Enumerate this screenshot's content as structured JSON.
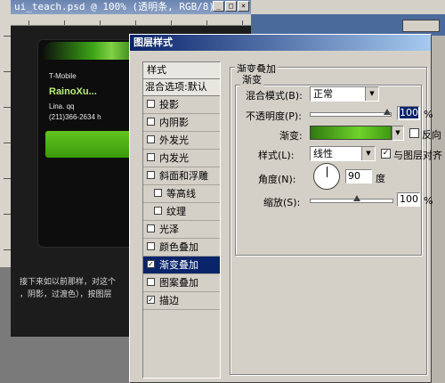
{
  "document": {
    "title": "ui_teach.psd @ 100% (透明条, RGB/8)",
    "phone": {
      "carrier": "T-Mobile",
      "name": "RainoXu...",
      "line1": "Lina. qq",
      "line2": "(211)366-2634 h"
    },
    "tutorial_text_line1": "接下来如以前那样，对这个",
    "tutorial_text_line2": "，阴影，过渡色），按图层"
  },
  "dialog": {
    "title": "图层样式",
    "styles_header": "样式",
    "blend_options": "混合选项:默认",
    "effects": [
      {
        "label": "投影",
        "checked": false,
        "sub": false
      },
      {
        "label": "内阴影",
        "checked": false,
        "sub": false
      },
      {
        "label": "外发光",
        "checked": false,
        "sub": false
      },
      {
        "label": "内发光",
        "checked": false,
        "sub": false
      },
      {
        "label": "斜面和浮雕",
        "checked": false,
        "sub": false
      },
      {
        "label": "等高线",
        "checked": false,
        "sub": true
      },
      {
        "label": "纹理",
        "checked": false,
        "sub": true
      },
      {
        "label": "光泽",
        "checked": false,
        "sub": false
      },
      {
        "label": "颜色叠加",
        "checked": false,
        "sub": false
      },
      {
        "label": "渐变叠加",
        "checked": true,
        "sub": false,
        "selected": true
      },
      {
        "label": "图案叠加",
        "checked": false,
        "sub": false
      },
      {
        "label": "描边",
        "checked": true,
        "sub": false
      }
    ],
    "section_title": "渐变叠加",
    "subsection_title": "渐变",
    "blend_mode_label": "混合模式(B):",
    "blend_mode_value": "正常",
    "opacity_label": "不透明度(P):",
    "opacity_value": "100",
    "opacity_unit": "%",
    "gradient_label": "渐变:",
    "reverse_label": "反向",
    "style_label": "样式(L):",
    "style_value": "线性",
    "align_label": "与图层对齐",
    "align_checked": true,
    "angle_label": "角度(N):",
    "angle_value": "90",
    "angle_unit": "度",
    "scale_label": "缩放(S):",
    "scale_value": "100",
    "scale_unit": "%"
  }
}
